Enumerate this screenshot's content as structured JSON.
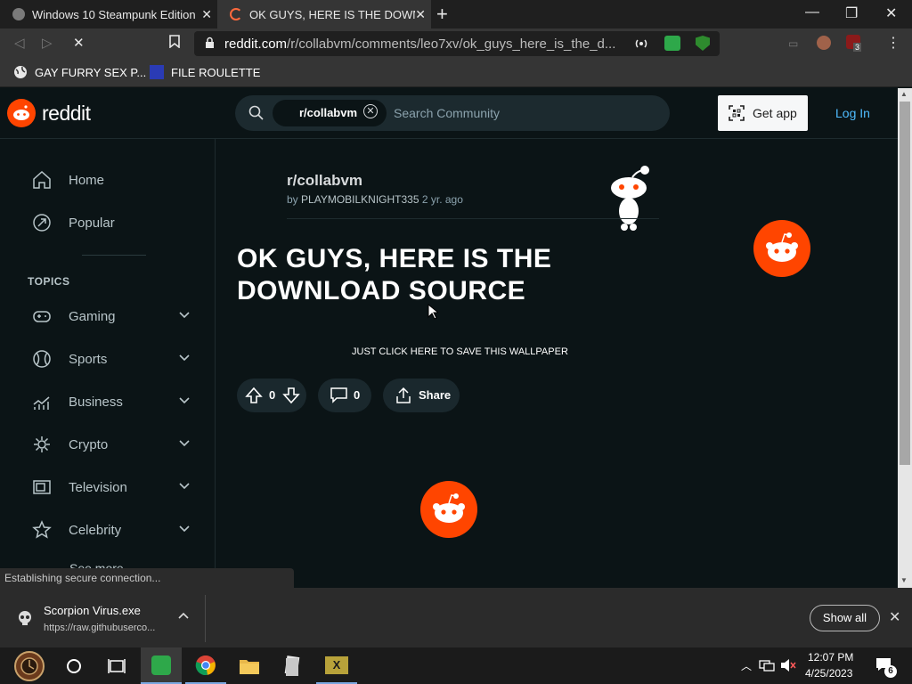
{
  "browser": {
    "tabs": [
      {
        "title": "Windows 10 Steampunk Edition -",
        "active": false
      },
      {
        "title": "OK GUYS, HERE IS THE DOWNL",
        "active": true
      }
    ],
    "url_host": "reddit.com",
    "url_path": "/r/collabvm/comments/leo7xv/ok_guys_here_is_the_d...",
    "bookmarks": [
      "GAY FURRY SEX P...",
      "FILE ROULETTE"
    ],
    "extension_badge": "3",
    "status_text": "Establishing secure connection..."
  },
  "reddit": {
    "wordmark": "reddit",
    "search_chip": "r/collabvm",
    "search_placeholder": "Search Community",
    "get_app": "Get app",
    "login": "Log In",
    "sidebar": {
      "main": [
        {
          "label": "Home",
          "icon": "home-icon"
        },
        {
          "label": "Popular",
          "icon": "popular-icon"
        }
      ],
      "topics_heading": "TOPICS",
      "topics": [
        {
          "label": "Gaming",
          "icon": "gamepad-icon"
        },
        {
          "label": "Sports",
          "icon": "sports-icon"
        },
        {
          "label": "Business",
          "icon": "chart-icon"
        },
        {
          "label": "Crypto",
          "icon": "crypto-icon"
        },
        {
          "label": "Television",
          "icon": "tv-icon"
        },
        {
          "label": "Celebrity",
          "icon": "star-icon"
        }
      ],
      "see_more": "See more"
    },
    "post": {
      "subreddit": "r/collabvm",
      "by": "by",
      "author": "PLAYMOBILKNIGHT335",
      "age": "2 yr. ago",
      "title": "OK GUYS, HERE IS THE DOWNLOAD SOURCE",
      "link_text": "JUST CLICK HERE TO SAVE THIS WALLPAPER",
      "votes": "0",
      "comments": "0",
      "share": "Share"
    }
  },
  "downloads": {
    "file_name": "Scorpion Virus.exe",
    "file_url": "https://raw.githubuserco...",
    "show_all": "Show all"
  },
  "taskbar": {
    "time": "12:07 PM",
    "date": "4/25/2023",
    "notification_count": "6"
  },
  "colors": {
    "reddit_orange": "#ff4500",
    "link_blue": "#4fbcff",
    "page_bg": "#0b1416"
  }
}
